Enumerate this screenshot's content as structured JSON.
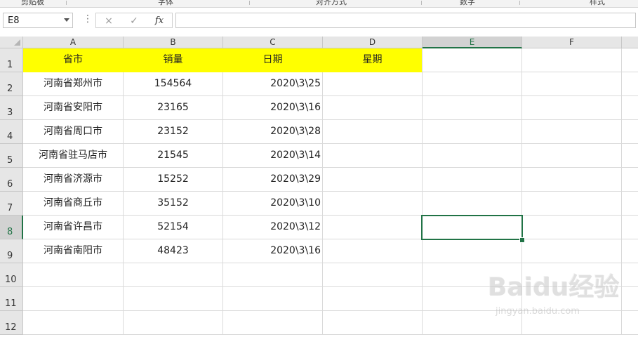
{
  "ribbon": {
    "groups": [
      {
        "label": "剪贴板"
      },
      {
        "label": "字体"
      },
      {
        "label": "对齐方式"
      },
      {
        "label": "数字"
      },
      {
        "label": "样式"
      }
    ]
  },
  "formula_bar": {
    "name_box": "E8",
    "options_icon": "more-options-icon",
    "cancel_icon": "×",
    "enter_icon": "✓",
    "fx_label": "fx",
    "formula_value": ""
  },
  "sheet": {
    "columns": [
      "A",
      "B",
      "C",
      "D",
      "E",
      "F"
    ],
    "rows": [
      "1",
      "2",
      "3",
      "4",
      "5",
      "6",
      "7",
      "8",
      "9",
      "10",
      "11",
      "12"
    ],
    "active_cell": "E8",
    "selected_column": "E",
    "selected_row": "8",
    "header_fill": "#ffff00",
    "selection_color": "#217346",
    "headers": [
      "省市",
      "销量",
      "日期",
      "星期"
    ],
    "data": [
      {
        "province": "河南省郑州市",
        "sales": "154564",
        "date": "2020\\3\\25",
        "weekday": ""
      },
      {
        "province": "河南省安阳市",
        "sales": "23165",
        "date": "2020\\3\\16",
        "weekday": ""
      },
      {
        "province": "河南省周口市",
        "sales": "23152",
        "date": "2020\\3\\28",
        "weekday": ""
      },
      {
        "province": "河南省驻马店市",
        "sales": "21545",
        "date": "2020\\3\\14",
        "weekday": ""
      },
      {
        "province": "河南省济源市",
        "sales": "15252",
        "date": "2020\\3\\29",
        "weekday": ""
      },
      {
        "province": "河南省商丘市",
        "sales": "35152",
        "date": "2020\\3\\10",
        "weekday": ""
      },
      {
        "province": "河南省许昌市",
        "sales": "52154",
        "date": "2020\\3\\12",
        "weekday": ""
      },
      {
        "province": "河南省南阳市",
        "sales": "48423",
        "date": "2020\\3\\16",
        "weekday": ""
      }
    ]
  },
  "watermark": {
    "brand": "Baidu经验",
    "url": "jingyan.baidu.com"
  }
}
